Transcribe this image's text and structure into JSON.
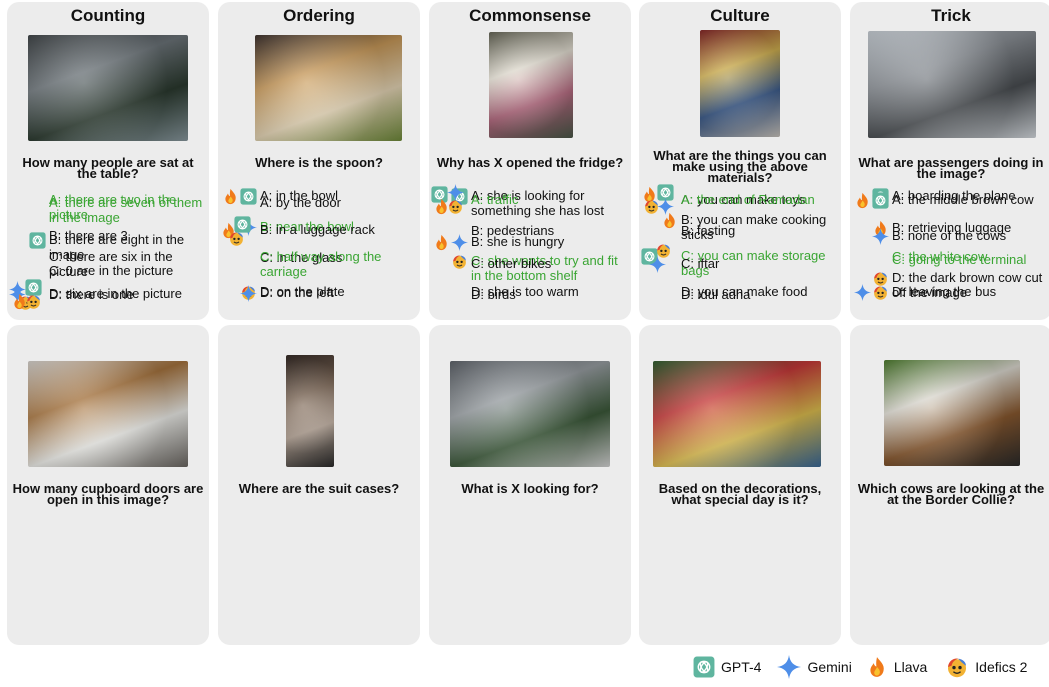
{
  "legend": [
    {
      "icon": "gpt4-icon",
      "label": "GPT-4"
    },
    {
      "icon": "gemini-icon",
      "label": "Gemini"
    },
    {
      "icon": "llava-icon",
      "label": "Llava"
    },
    {
      "icon": "idefics-icon",
      "label": "Idefics 2"
    }
  ],
  "colors": {
    "correct": "#3aa533",
    "card": "#ececec",
    "gpt4": "#5fb59f",
    "gemini": "#4e8ee8",
    "llava": "#f07a1a",
    "idefics": "#f2b233"
  },
  "cards": [
    {
      "category": "Counting",
      "question": "How many people are sat at the table?",
      "photo": "people-at-laptops-photo",
      "options": [
        {
          "label": "A: there are seven of them in the image",
          "correct": true,
          "icons": []
        },
        {
          "label": "B: there are eight in the image",
          "correct": false,
          "icons": [
            "gpt4"
          ]
        },
        {
          "label": "C: 0 are in the picture",
          "correct": false,
          "icons": []
        },
        {
          "label": "D: six are in the picture",
          "correct": false,
          "icons": [
            "gemini",
            "llava",
            "idefics"
          ]
        }
      ]
    },
    {
      "category": "Ordering",
      "question": "Where is the spoon?",
      "photo": "food-tray-photo",
      "options": [
        {
          "label": "A: in the bowl",
          "correct": false,
          "icons": [
            "llava",
            "gpt4"
          ]
        },
        {
          "label": "B: near the bowl",
          "correct": true,
          "icons": [
            "gemini"
          ]
        },
        {
          "label": "C: in the glass",
          "correct": false,
          "icons": []
        },
        {
          "label": "D: on the plate",
          "correct": false,
          "icons": [
            "idefics"
          ]
        }
      ]
    },
    {
      "category": "Commonsense",
      "question": "Why has X opened the fridge?",
      "photo": "child-at-fridge-photo",
      "options": [
        {
          "label": "A: she is looking for something she has lost",
          "correct": false,
          "icons": [
            "gpt4"
          ]
        },
        {
          "label": "B: she is hungry",
          "correct": false,
          "icons": [
            "llava",
            "gemini"
          ]
        },
        {
          "label": "C: she wants to try and fit in the bottom shelf",
          "correct": true,
          "icons": [
            "idefics"
          ]
        },
        {
          "label": "D: she is too warm",
          "correct": false,
          "icons": []
        }
      ]
    },
    {
      "category": "Culture",
      "question": "What are the things you can make using the above materials?",
      "photo": "fabric-patchwork-photo",
      "options": [
        {
          "label": "A: you can make toys",
          "correct": false,
          "icons": []
        },
        {
          "label": "B: you can make cooking sticks",
          "correct": false,
          "icons": [
            "llava"
          ]
        },
        {
          "label": "C: you can make storage bags",
          "correct": true,
          "icons": [
            "gpt4",
            "idefics",
            "gemini"
          ]
        },
        {
          "label": "D: you can make food",
          "correct": false,
          "icons": []
        }
      ]
    },
    {
      "category": "Trick",
      "question": "What are passengers doing in the image?",
      "photo": "airplane-engine-photo",
      "options": [
        {
          "label": "A: boarding the plane",
          "correct": false,
          "icons": [
            "gpt4"
          ]
        },
        {
          "label": "B: retrieving luggage",
          "correct": false,
          "icons": [
            "llava"
          ]
        },
        {
          "label": "C: going to the terminal",
          "correct": true,
          "icons": []
        },
        {
          "label": "D: leaving the bus",
          "correct": false,
          "icons": [
            "gemini",
            "idefics"
          ]
        }
      ]
    },
    {
      "category": "",
      "question": "How many cupboard doors are open in this image?",
      "photo": "kitchen-photo",
      "options": [
        {
          "label": "A: there are two in the picture",
          "correct": true,
          "icons": []
        },
        {
          "label": "B: there are 3",
          "correct": false,
          "icons": []
        },
        {
          "label": "C: there are six in the picture",
          "correct": false,
          "icons": []
        },
        {
          "label": "D: there is one",
          "correct": false,
          "icons": [
            "gemini",
            "gpt4",
            "llava",
            "idefics"
          ]
        }
      ]
    },
    {
      "category": "",
      "question": "Where are the suit cases?",
      "photo": "luggage-rack-photo",
      "options": [
        {
          "label": "A: by the door",
          "correct": false,
          "icons": []
        },
        {
          "label": "B: in a luggage rack",
          "correct": false,
          "icons": [
            "llava",
            "gpt4",
            "idefics"
          ]
        },
        {
          "label": "C: half way along the carriage",
          "correct": true,
          "icons": []
        },
        {
          "label": "D: on the left",
          "correct": false,
          "icons": [
            "gemini"
          ]
        }
      ]
    },
    {
      "category": "",
      "question": "What is X looking for?",
      "photo": "street-cyclist-photo",
      "options": [
        {
          "label": "A: traffic",
          "correct": true,
          "icons": [
            "gpt4",
            "gemini",
            "llava",
            "idefics"
          ]
        },
        {
          "label": "B: pedestrians",
          "correct": false,
          "icons": []
        },
        {
          "label": "C: other bikes",
          "correct": false,
          "icons": []
        },
        {
          "label": "D: birds",
          "correct": false,
          "icons": []
        }
      ]
    },
    {
      "category": "",
      "question": "Based on the decorations, what special day is it?",
      "photo": "mall-decorations-photo",
      "options": [
        {
          "label": "A: the end of Ramadan",
          "correct": true,
          "icons": [
            "llava",
            "gpt4",
            "idefics",
            "gemini"
          ]
        },
        {
          "label": "B: fasting",
          "correct": false,
          "icons": []
        },
        {
          "label": "C: iftar",
          "correct": false,
          "icons": []
        },
        {
          "label": "D: idul adha",
          "correct": false,
          "icons": []
        }
      ]
    },
    {
      "category": "",
      "question": "Which cows are looking at the at the Border Collie?",
      "photo": "cows-dog-photo",
      "options": [
        {
          "label": "A: the middle brown cow",
          "correct": false,
          "icons": [
            "llava",
            "gpt4"
          ]
        },
        {
          "label": "B: none of the cows",
          "correct": false,
          "icons": [
            "gemini"
          ]
        },
        {
          "label": "C: the white cow",
          "correct": true,
          "icons": []
        },
        {
          "label": "D: the dark brown cow cut off the image",
          "correct": false,
          "icons": [
            "idefics"
          ]
        }
      ]
    }
  ]
}
